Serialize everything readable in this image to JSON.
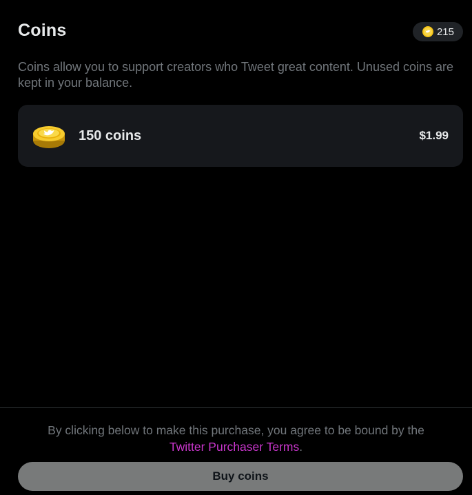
{
  "header": {
    "title": "Coins",
    "balance": "215",
    "balance_icon": "coin-icon"
  },
  "description": "Coins allow you to support creators who Tweet great content. Unused coins are kept in your balance.",
  "packages": [
    {
      "icon": "coin-stack-icon",
      "label": "150 coins",
      "price": "$1.99"
    }
  ],
  "footer": {
    "terms_prefix": "By clicking below to make this purchase, you agree to be bound by the",
    "terms_link": "Twitter Purchaser Terms",
    "terms_suffix": ".",
    "buy_label": "Buy coins"
  },
  "colors": {
    "background": "#000000",
    "card": "#16181c",
    "link": "#c936cc",
    "coin_gold": "#f5c518",
    "button_disabled": "#787a7a"
  }
}
